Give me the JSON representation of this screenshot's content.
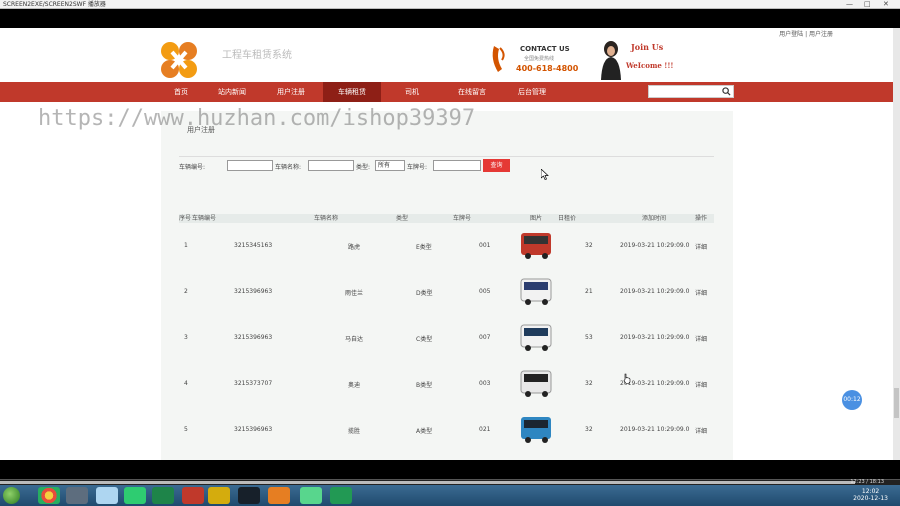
{
  "player": {
    "title": "SCREEN2EXE/SCREEN2SWF 播放器",
    "controls": [
      "—",
      "□",
      "✕"
    ],
    "time": "12:23 / 18:13"
  },
  "site": {
    "top_links": "用户登陆 | 用户注册",
    "title": "工程车租赁系统",
    "contact_title": "CONTACT US",
    "contact_sub": "全国免费热线",
    "phone": "400-618-4800",
    "join_line1": "Join Us",
    "join_line2": "WeIcome !!!",
    "nav": [
      "首页",
      "站内新闻",
      "用户注册",
      "车辆租赁",
      "司机",
      "在线留言",
      "后台管理"
    ],
    "nav_active_index": 3,
    "search_placeholder": ""
  },
  "watermark": "https://www.huzhan.com/ishop39397",
  "content": {
    "breadcrumb": "用户注册",
    "filter": {
      "code_label": "车辆编号:",
      "name_label": "车辆名称:",
      "type_label": "类型:",
      "type_value": "所有",
      "plate_label": "车牌号:",
      "button": "查询"
    },
    "columns": [
      "序号",
      "车辆编号",
      "车辆名称",
      "类型",
      "车牌号",
      "图片",
      "日租价",
      "添加时间",
      "操作"
    ],
    "rows": [
      {
        "no": "1",
        "code": "3215345163",
        "name": "路虎",
        "type": "E类型",
        "plate": "001",
        "price": "32",
        "time": "2019-03-21 10:29:09.0",
        "op": "详细",
        "bus_color": "#c0392b"
      },
      {
        "no": "2",
        "code": "3215396963",
        "name": "雨佳兰",
        "type": "D类型",
        "plate": "005",
        "price": "21",
        "time": "2019-03-21 10:29:09.0",
        "op": "详细",
        "bus_color": "#f2f2f2"
      },
      {
        "no": "3",
        "code": "3215396963",
        "name": "马自达",
        "type": "C类型",
        "plate": "007",
        "price": "53",
        "time": "2019-03-21 10:29:09.0",
        "op": "详细",
        "bus_color": "#f2f2f2"
      },
      {
        "no": "4",
        "code": "3215373707",
        "name": "奥迪",
        "type": "B类型",
        "plate": "003",
        "price": "32",
        "time": "2019-03-21 10:29:09.0",
        "op": "详细",
        "bus_color": "#e8e8e8"
      },
      {
        "no": "5",
        "code": "3215396963",
        "name": "揽胜",
        "type": "A类型",
        "plate": "021",
        "price": "32",
        "time": "2019-03-21 10:29:09.0",
        "op": "详细",
        "bus_color": "#2e86c1"
      }
    ]
  },
  "badge": "00:12",
  "clock": {
    "time": "12:02",
    "date": "2020-12-13"
  },
  "colors": {
    "brand_red": "#c0392b",
    "nav_active": "#8e1f16",
    "button_red": "#e53935"
  }
}
